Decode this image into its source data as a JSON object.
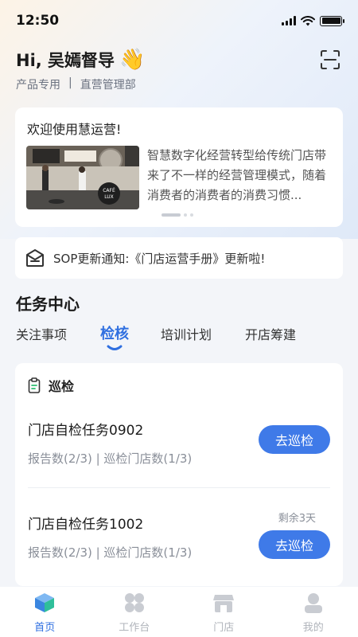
{
  "status_bar": {
    "time": "12:50"
  },
  "header": {
    "greeting": "Hi, 吴嫣督导",
    "wave_emoji": "👋",
    "role": "产品专用",
    "separator": "|",
    "department": "直营管理部",
    "scan_icon": "scan-icon"
  },
  "welcome": {
    "title": "欢迎使用慧运营!",
    "description": "智慧数字化经营转型给传统门店带来了不一样的经营管理模式，随着消费者的消费者的消费习惯..."
  },
  "notice": {
    "icon": "announcement-icon",
    "text": "SOP更新通知:《门店运营手册》更新啦!"
  },
  "task_center": {
    "title": "任务中心",
    "tabs": [
      {
        "label": "关注事项",
        "active": false
      },
      {
        "label": "检核",
        "active": true
      },
      {
        "label": "培训计划",
        "active": false
      },
      {
        "label": "开店筹建",
        "active": false
      }
    ],
    "section_label": "巡检",
    "tasks": [
      {
        "name": "门店自检任务0902",
        "meta": "报告数(2/3) | 巡检门店数(1/3)",
        "button": "去巡检",
        "remain": ""
      },
      {
        "name": "门店自检任务1002",
        "meta": "报告数(2/3) | 巡检门店数(1/3)",
        "button": "去巡检",
        "remain": "剩余3天"
      }
    ]
  },
  "tabbar": [
    {
      "label": "首页",
      "icon": "home-cube-icon",
      "active": true
    },
    {
      "label": "工作台",
      "icon": "workbench-grid-icon",
      "active": false
    },
    {
      "label": "门店",
      "icon": "store-icon",
      "active": false
    },
    {
      "label": "我的",
      "icon": "profile-icon",
      "active": false
    }
  ],
  "colors": {
    "accent": "#3f7ae8",
    "tab_active": "#2f6fe0"
  }
}
